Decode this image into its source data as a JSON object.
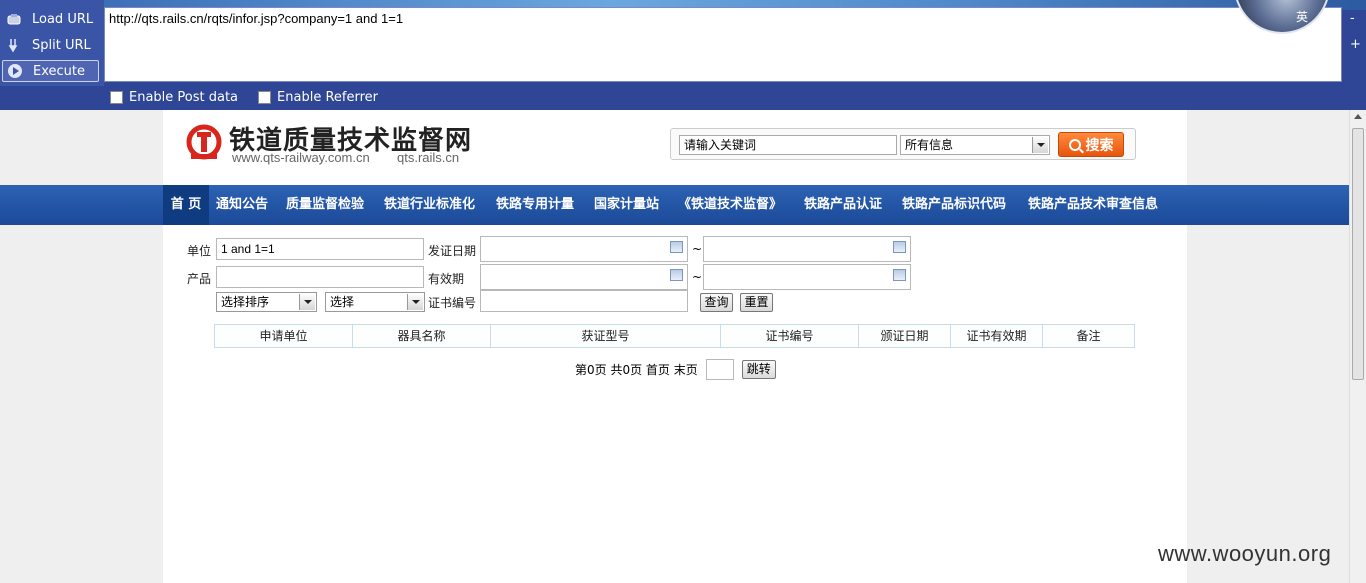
{
  "hackbar": {
    "load_label": "Load URL",
    "split_label": "Split URL",
    "execute_label": "Execute",
    "url_value": "http://qts.rails.cn/rqts/infor.jsp?company=1 and 1=1",
    "post_label": "Enable Post data",
    "referrer_label": "Enable Referrer",
    "minus": "-",
    "plus": "+",
    "avatar_char": "英"
  },
  "site": {
    "title": "铁道质量技术监督网",
    "url_primary": "www.qts-railway.com.cn",
    "url_secondary": "qts.rails.cn"
  },
  "search": {
    "placeholder": "请输入关键词",
    "scope_selected": "所有信息",
    "button": "搜索"
  },
  "nav": {
    "items": [
      "首 页",
      "通知公告",
      "质量监督检验",
      "铁道行业标准化",
      "铁路专用计量",
      "国家计量站",
      "《铁道技术监督》",
      "铁路产品认证",
      "铁路产品标识代码",
      "铁路产品技术审查信息"
    ]
  },
  "form": {
    "unit_label": "单位",
    "unit_value": "1 and 1=1",
    "issue_date_label": "发证日期",
    "product_label": "产品",
    "validity_label": "有效期",
    "tilde": "~",
    "sort_selected": "选择排序",
    "select_selected": "选择",
    "cert_no_label": "证书编号",
    "query_button": "查询",
    "reset_button": "重置"
  },
  "table": {
    "columns": [
      "申请单位",
      "器具名称",
      "获证型号",
      "证书编号",
      "颁证日期",
      "证书有效期",
      "备注"
    ]
  },
  "pager": {
    "text": "第0页 共0页 首页 末页",
    "jump_button": "跳转"
  },
  "watermark": "www.wooyun.org",
  "colors": {
    "hackbar_bg": "#2e4695",
    "nav_bg": "#1b4a98",
    "search_button": "#e8550d",
    "logo_red": "#d9261c"
  }
}
